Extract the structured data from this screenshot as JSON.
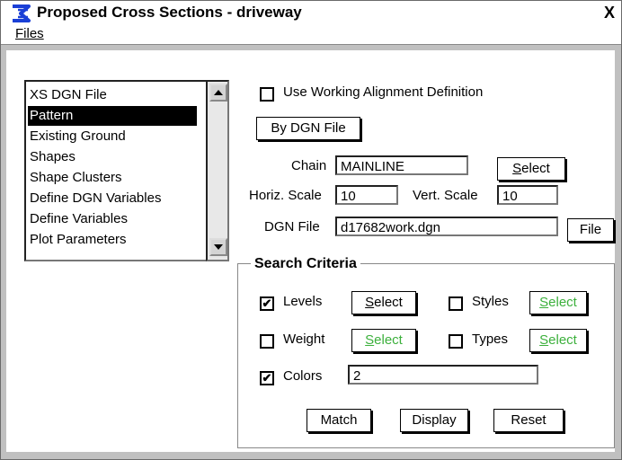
{
  "window": {
    "title": "Proposed Cross Sections - driveway",
    "close_label": "X"
  },
  "menubar": {
    "files_first": "F",
    "files_rest": "iles"
  },
  "list": {
    "items": [
      "XS DGN File",
      "Pattern",
      "Existing Ground",
      "Shapes",
      "Shape Clusters",
      "Define DGN Variables",
      "Define Variables",
      "Plot Parameters"
    ],
    "selected_index": 1
  },
  "options": {
    "use_working_alignment_label": "Use Working Alignment Definition",
    "use_working_alignment_checked": false,
    "by_dgn_file_label": "By DGN File"
  },
  "chain": {
    "label": "Chain",
    "value": "MAINLINE",
    "select_first": "S",
    "select_rest": "elect"
  },
  "scale": {
    "horiz_label": "Horiz. Scale",
    "horiz_value": "10",
    "vert_label": "Vert. Scale",
    "vert_value": "10"
  },
  "dgn_file": {
    "label": "DGN File",
    "value": "d17682work.dgn",
    "file_button": "File"
  },
  "search": {
    "title": "Search Criteria",
    "levels_label": "Levels",
    "levels_checked": true,
    "styles_label": "Styles",
    "styles_checked": false,
    "weight_label": "Weight",
    "weight_checked": false,
    "types_label": "Types",
    "types_checked": false,
    "colors_label": "Colors",
    "colors_checked": true,
    "colors_value": "2",
    "select_first": "S",
    "select_rest": "elect",
    "active_color": "#000000",
    "inactive_color": "#3cb03c"
  },
  "actions": {
    "match": "Match",
    "display": "Display",
    "reset": "Reset"
  }
}
